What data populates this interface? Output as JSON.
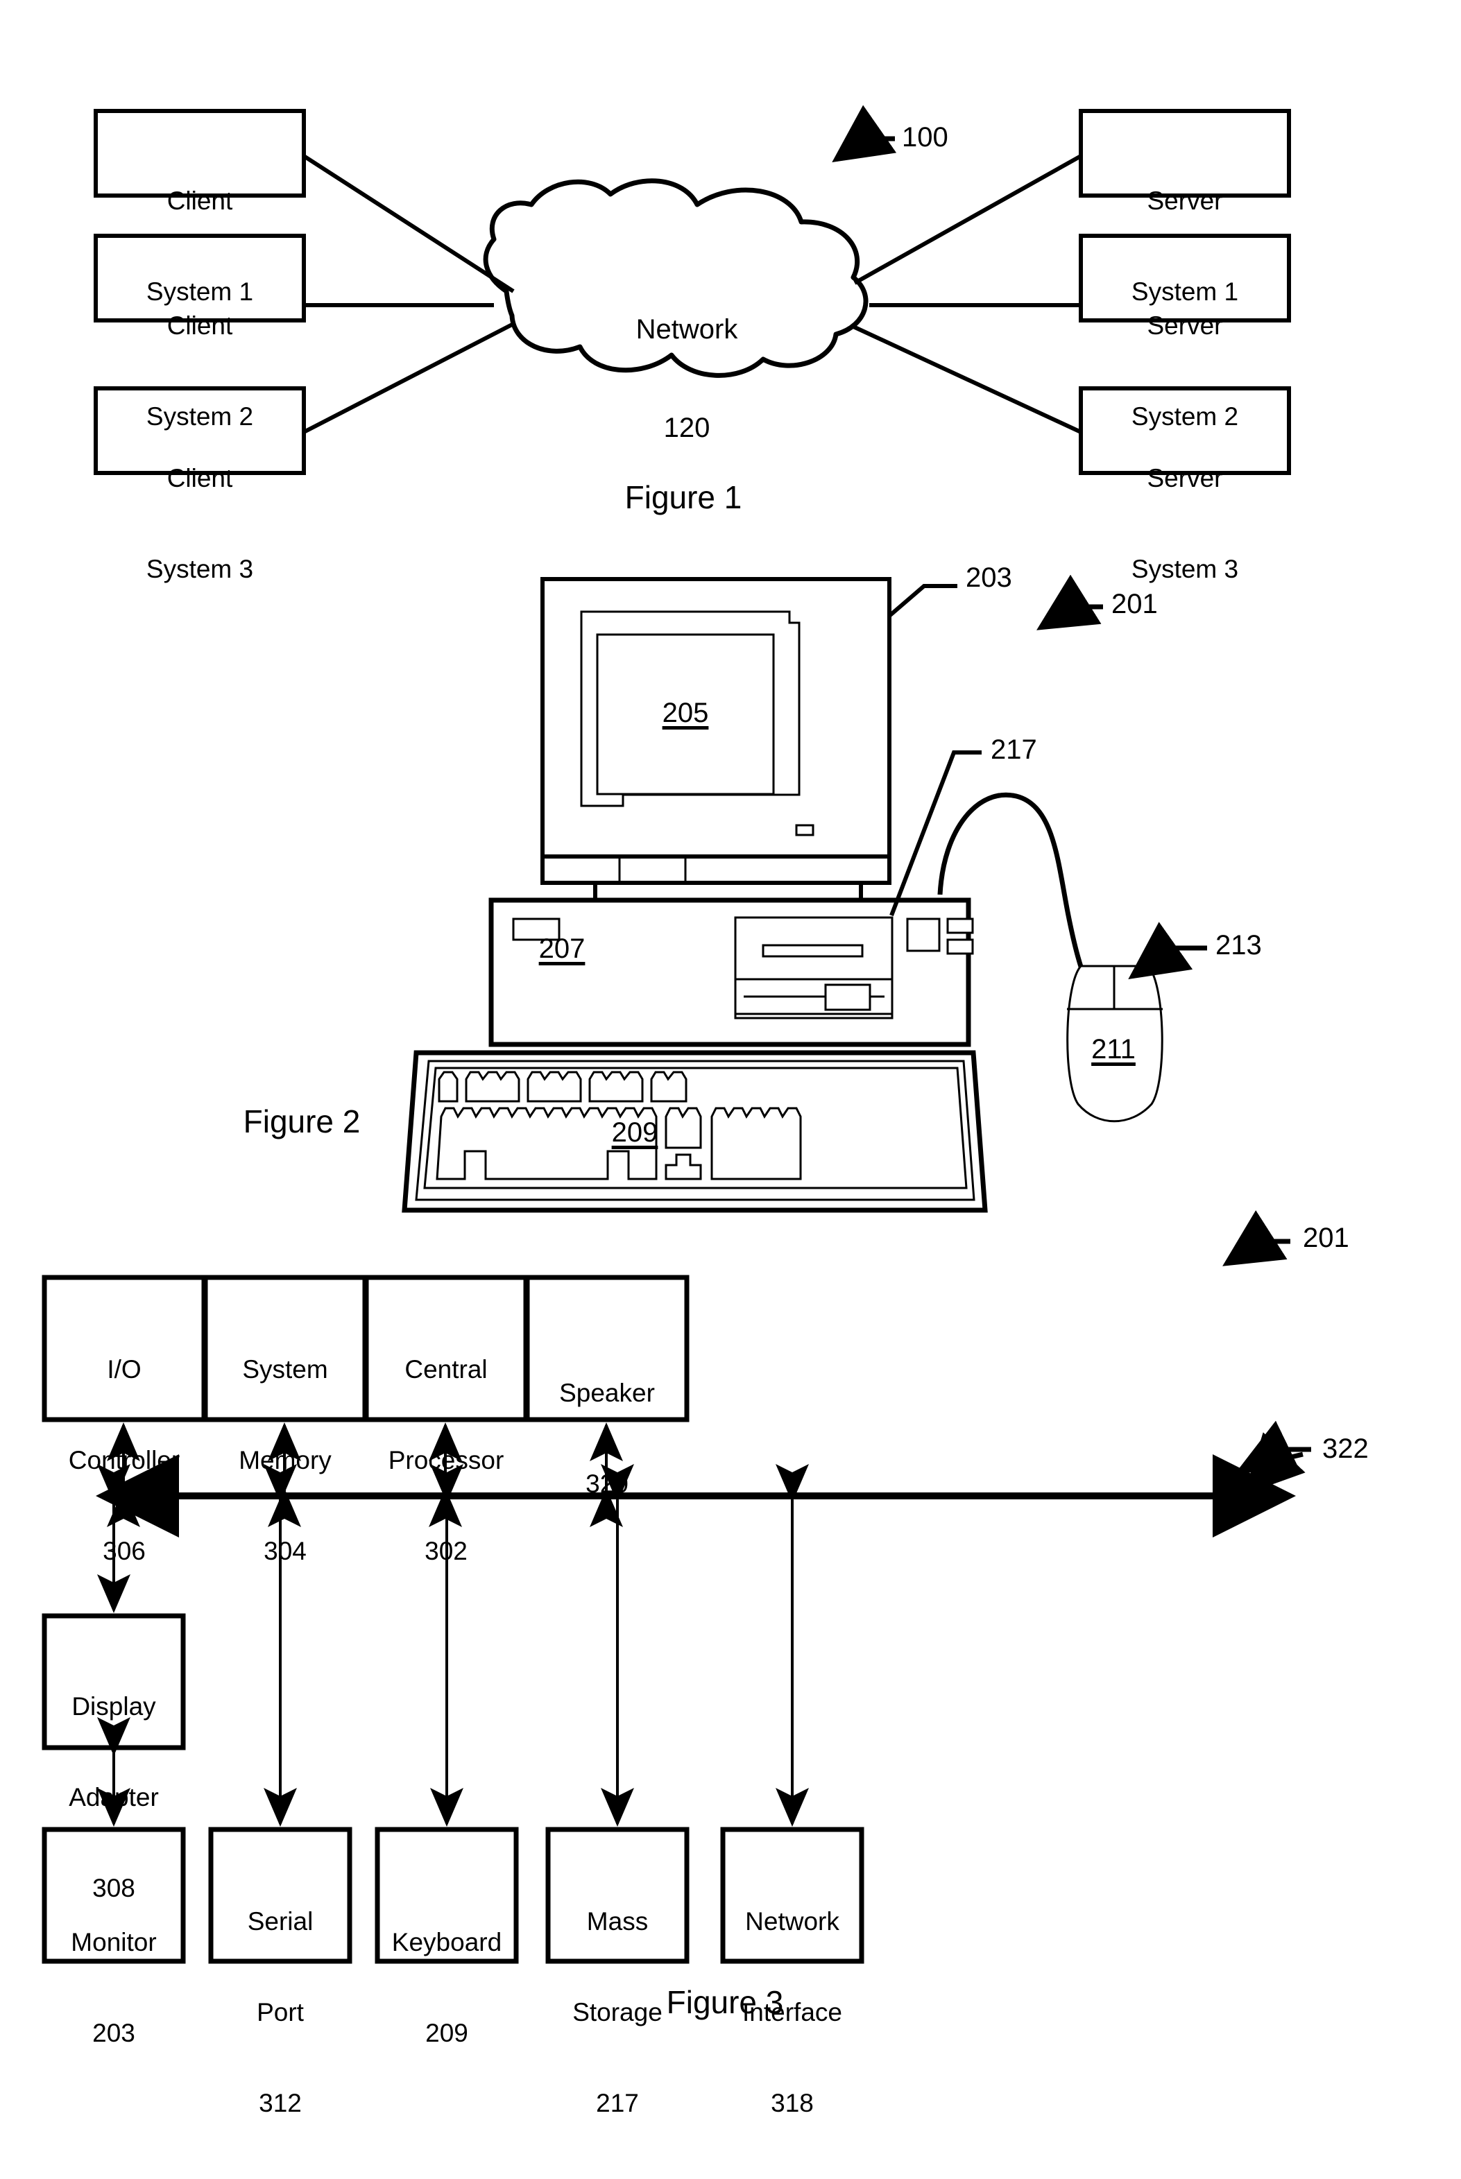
{
  "figure1": {
    "caption": "Figure 1",
    "system_ref": "100",
    "network": {
      "label": "Network",
      "ref": "120"
    },
    "clients": [
      {
        "line1": "Client",
        "line2": "System 1"
      },
      {
        "line1": "Client",
        "line2": "System 2"
      },
      {
        "line1": "Client",
        "line2": "System 3"
      }
    ],
    "servers": [
      {
        "line1": "Server",
        "line2": "System 1"
      },
      {
        "line1": "Server",
        "line2": "System 2"
      },
      {
        "line1": "Server",
        "line2": "System 3"
      }
    ]
  },
  "figure2": {
    "caption": "Figure 2",
    "system_ref": "201",
    "monitor_ref": "203",
    "screen_ref": "205",
    "chassis_ref": "207",
    "keyboard_ref": "209",
    "mouse_ref": "211",
    "mouse_button_ref": "213",
    "storage_ref": "217"
  },
  "figure3": {
    "caption": "Figure 3",
    "system_ref": "201",
    "bus_ref": "322",
    "top_row": [
      {
        "line1": "I/O",
        "line2": "Controller",
        "ref": "306"
      },
      {
        "line1": "System",
        "line2": "Memory",
        "ref": "304"
      },
      {
        "line1": "Central",
        "line2": "Processor",
        "ref": "302"
      },
      {
        "line1": "Speaker",
        "line2": "",
        "ref": "320"
      }
    ],
    "display_adapter": {
      "line1": "Display",
      "line2": "Adapter",
      "ref": "308"
    },
    "bottom_row": [
      {
        "line1": "Monitor",
        "line2": "",
        "ref": "203"
      },
      {
        "line1": "Serial",
        "line2": "Port",
        "ref": "312"
      },
      {
        "line1": "Keyboard",
        "line2": "",
        "ref": "209"
      },
      {
        "line1": "Mass",
        "line2": "Storage",
        "ref": "217"
      },
      {
        "line1": "Network",
        "line2": "Interface",
        "ref": "318"
      }
    ]
  },
  "colors": {
    "ink": "#000000",
    "paper": "#ffffff"
  }
}
